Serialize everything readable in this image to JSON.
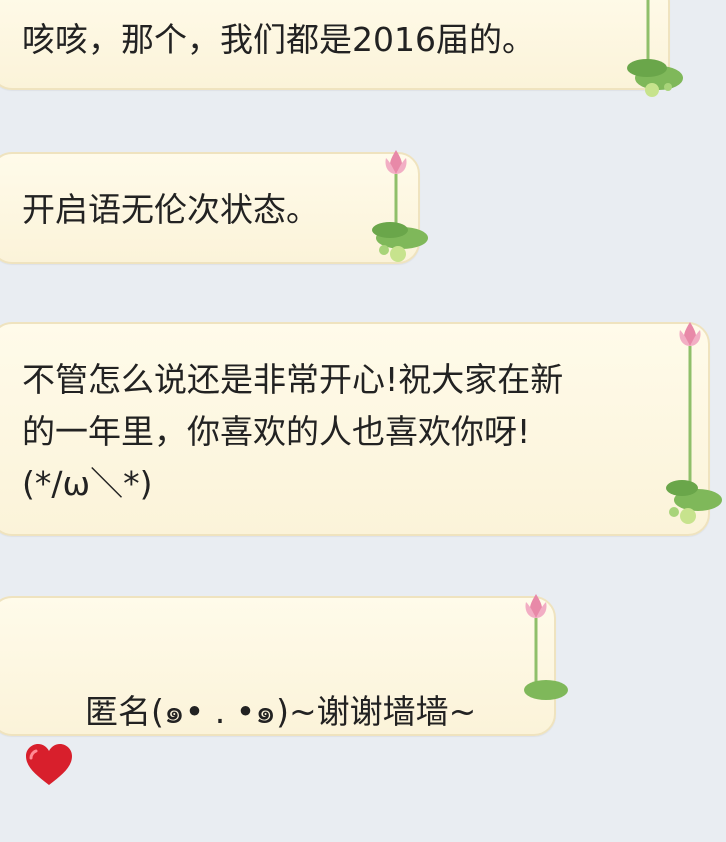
{
  "messages": [
    {
      "text": "咳咳，那个，我们都是2016届的。"
    },
    {
      "text": "开启语无伦次状态。"
    },
    {
      "text": "不管怎么说还是非常开心!祝大家在新\n的一年里，你喜欢的人也喜欢你呀!\n(*/ω＼*)"
    },
    {
      "text": "匿名(๑• . •๑)~谢谢墙墙~"
    }
  ],
  "colors": {
    "background": "#e9edf2",
    "bubble_fill": "#fdf7e2",
    "bubble_border": "#efe3bf",
    "lotus_pink": "#e889a8",
    "lotus_leaf": "#7fb85a",
    "heart_red": "#d81f2c"
  },
  "icons": [
    "lotus-icon",
    "heart-icon"
  ]
}
